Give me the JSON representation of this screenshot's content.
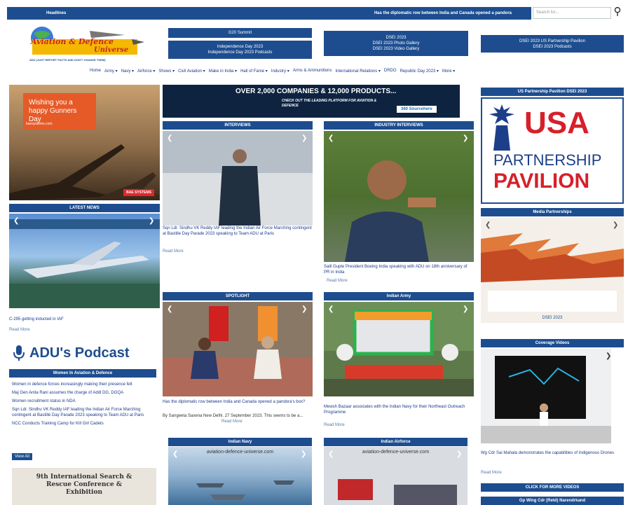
{
  "header": {
    "headlines_label": "Headlines",
    "ticker": "Has the diplomatic row between India and Canada opened a pandora",
    "search_placeholder": "Search for..."
  },
  "logo": {
    "line1": "Aviation & Defence",
    "line2": "Universe",
    "tagline": "ADU (JUST REPORT FACTS AND DON'T CHANGE THEM)"
  },
  "top_buttons": {
    "g20_summit": "G20 Summit",
    "independence_day": "Independence Day 2023",
    "independence_podcasts": "Independence Day 2023 Podcasts",
    "dsei_2023": "DSEI 2023",
    "dsei_photo": "DSEI 2023 Photo Gallery",
    "dsei_video": "DSEI 2023 Video Gallery",
    "dsei_us_pavilion": "DSEI 2023 US Partnership Pavilion",
    "dsei_podcasts": "DSEI 2023 Podcasts"
  },
  "nav": [
    "Home",
    "Army ▾",
    "Navy ▾",
    "Airforce ▾",
    "Shows ▾",
    "Civil Aviation ▾",
    "Make in India ▾",
    "Hall of Fame ▾",
    "Industry ▾",
    "Arms & Ammunitions",
    "International Relations ▾",
    "DRDO",
    "Republic Day 2023 ▾",
    "More ▾"
  ],
  "ads": {
    "gunners_day_line1": "Wishing you a",
    "gunners_day_line2": "happy Gunners Day",
    "gunners_site": "baesystems.com",
    "bae_logo": "BAE SYSTEMS",
    "banner_main": "OVER 2,000 COMPANIES & 12,000 PRODUCTS...",
    "banner_sub": "CHECK OUT THE LEADING PLATFORM FOR AVIATION & DEFENCE",
    "banner_brand": "360 Sourcehere"
  },
  "sections": {
    "latest_news": "LATEST NEWS",
    "interviews": "INTERVIEWS",
    "industry_interviews": "INDUSTRY INTERVIEWS",
    "us_pavilion": "US Partnership Pavilion DSEI 2023",
    "media_partnerships": "Media Partnerships",
    "spotlight": "SPOTLIGHT",
    "indian_army": "Indian Army",
    "coverage_videos": "Coverage Videos",
    "women": "Women In Aviation & Defence",
    "indian_navy": "Indian Navy",
    "indian_airforce": "Indian Airforce",
    "click_more_videos": "CLICK FOR MORE VIDEOS"
  },
  "usa": {
    "usa": "USA",
    "partnership": "PARTNERSHIP",
    "pavilion": "PAVILION"
  },
  "media_partner": {
    "date": "DSEI 2023"
  },
  "latest_news": {
    "caption": "C-295 getting inducted in IAF",
    "read_more": "Read More"
  },
  "interview": {
    "caption": "Sqn Ldr. Sindhu VK Reddy IAF leading the Indian Air Force Marching contingent at Bastille Day Parade 2023 speaking to Team ADU at Paris",
    "read_more": "Read More"
  },
  "industry_interview": {
    "caption": "Salil Gupte President Boeing India speaking with ADU on 18th anniversary of PR in India",
    "read_more": "Read More"
  },
  "spotlight": {
    "caption": "Has the diplomatic row between India and Canada opened a pandora's box?",
    "byline": "By Sangeeta Saxena New Delhi. 27 September 2023. This seems to be a...",
    "read_more": "Read More"
  },
  "army": {
    "caption": "Mewsh Bazaar associates with the Indian Navy for their Northeast Outreach Programme",
    "read_more": "Read More"
  },
  "coverage": {
    "caption": "Wg Cdr Sai Mahala demonstrates the capabilities of Indigenous Drones",
    "read_more": "Read More",
    "next_item": "Gp Wing Cdr (Retd) Narendrkand"
  },
  "podcast": {
    "title": "ADU's Podcast"
  },
  "women_list": [
    "Women in defence forces increasingly making their presence felt",
    "Maj Gen Anita Rani assumes the charge of Addl DG, DGQA",
    "Women recruitment status in NDA",
    "Sqn Ldr. Sindhu VK Reddy IAF leading the Indian Air Force Marching contingent at Bastille Day Parade 2023 speaking to Team ADU at Paris",
    "NCC Conducts Training Camp for Kill Girl Cadets"
  ],
  "view_all": "View All",
  "sar_ad": {
    "line1": "9th International Search &",
    "line2": "Rescue Conference &",
    "line3": "Exhibition"
  },
  "watermark": "aviation-defence-universe.com"
}
